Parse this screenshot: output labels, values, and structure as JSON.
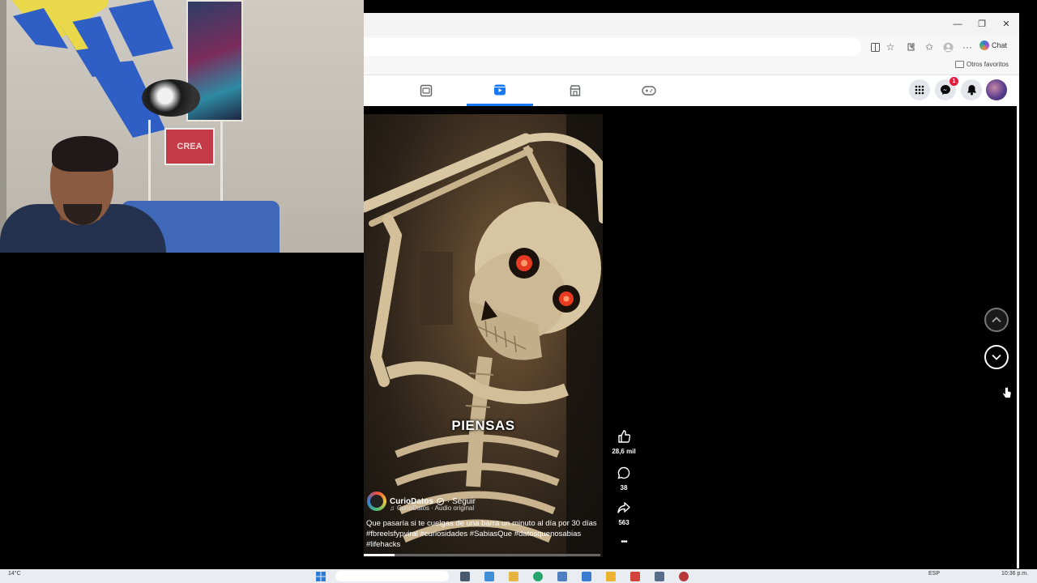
{
  "webcam": {
    "sign_text": "CREA"
  },
  "browser": {
    "window_controls": {
      "minimize": "—",
      "maximize": "❐",
      "close": "✕"
    },
    "chat_label": "Chat",
    "favorites_label": "Otros favoritos"
  },
  "facebook": {
    "nav_tabs": [
      {
        "name": "feed",
        "icon": "news-feed-icon",
        "active": false
      },
      {
        "name": "reels",
        "icon": "video-icon",
        "active": true
      },
      {
        "name": "marketplace",
        "icon": "store-icon",
        "active": false
      },
      {
        "name": "gaming",
        "icon": "gamepad-icon",
        "active": false
      }
    ],
    "messenger_badge": "1"
  },
  "reel": {
    "overlay_caption": "PIENSAS",
    "author": "CurioDatos",
    "follow_label": "· Seguir",
    "audio": "CurioDatos · Audio original",
    "description": "Que pasaría si te cuelgas de una barra un minuto al día  por 30 días #fbreelsfypviral #curiosidades #SabiasQue #datosquenosabias #lifehacks",
    "progress": 0.13,
    "likes": "28,6 mil",
    "comments": "38",
    "shares": "563",
    "more": "•••"
  },
  "taskbar": {
    "weather": "14°C",
    "language": "ESP",
    "clock": "10:36 p.m."
  },
  "colors": {
    "accent": "#1877f2",
    "badge": "#e41e3f"
  }
}
